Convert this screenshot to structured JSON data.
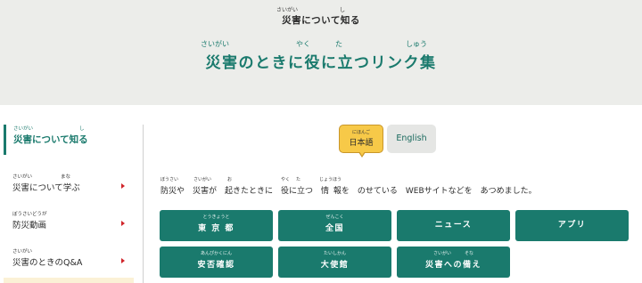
{
  "breadcrumb": {
    "ruby_saigai": "さいがい",
    "ruby_shi": "し",
    "text": "災害について知る"
  },
  "page_title": {
    "ruby_saigai": "さいがい",
    "ruby_yaku": "やく",
    "ruby_ta": "た",
    "ruby_shuu": "しゅう",
    "text": "災害のときに役に立つリンク集"
  },
  "sidebar": {
    "active": {
      "ruby_saigai": "さいがい",
      "ruby_shi": "し",
      "label": "災害について知る"
    },
    "items": [
      {
        "ruby_saigai": "さいがい",
        "ruby_mana": "まな",
        "label": "災害について学ぶ"
      },
      {
        "ruby": "ぼうさいどうが",
        "label": "防災動画"
      },
      {
        "ruby": "さいがい",
        "label": "災害のときのQ&A"
      }
    ]
  },
  "language": {
    "ja_ruby": "にほんご",
    "ja_label": "日本語",
    "en_label": "English"
  },
  "intro": {
    "ruby_bousai": "ぼうさい",
    "ruby_saigai": "さいがい",
    "ruby_o": "お",
    "ruby_yaku": "やく",
    "ruby_ta": "た",
    "ruby_jouhou": "じょうほう",
    "text": "防災や　災害が　起きたときに　役に立つ　情 報を　のせている　WEBサイトなどを　あつめました。"
  },
  "links": [
    {
      "ruby": "とうきょうと",
      "label": "東 京 都"
    },
    {
      "ruby": "ぜんこく",
      "label": "全国"
    },
    {
      "ruby": "",
      "label": "ニュース"
    },
    {
      "ruby": "",
      "label": "アプリ"
    },
    {
      "ruby": "あんぴかくにん",
      "label": "安否確認"
    },
    {
      "ruby": "たいしかん",
      "label": "大使館"
    },
    {
      "ruby": "さいがい　　　そな",
      "label": "災害への備え"
    }
  ],
  "colors": {
    "brand_teal": "#1a7a6d",
    "header_bg": "#ecedea",
    "lang_active": "#f7c948",
    "arrow_red": "#d0242a"
  }
}
